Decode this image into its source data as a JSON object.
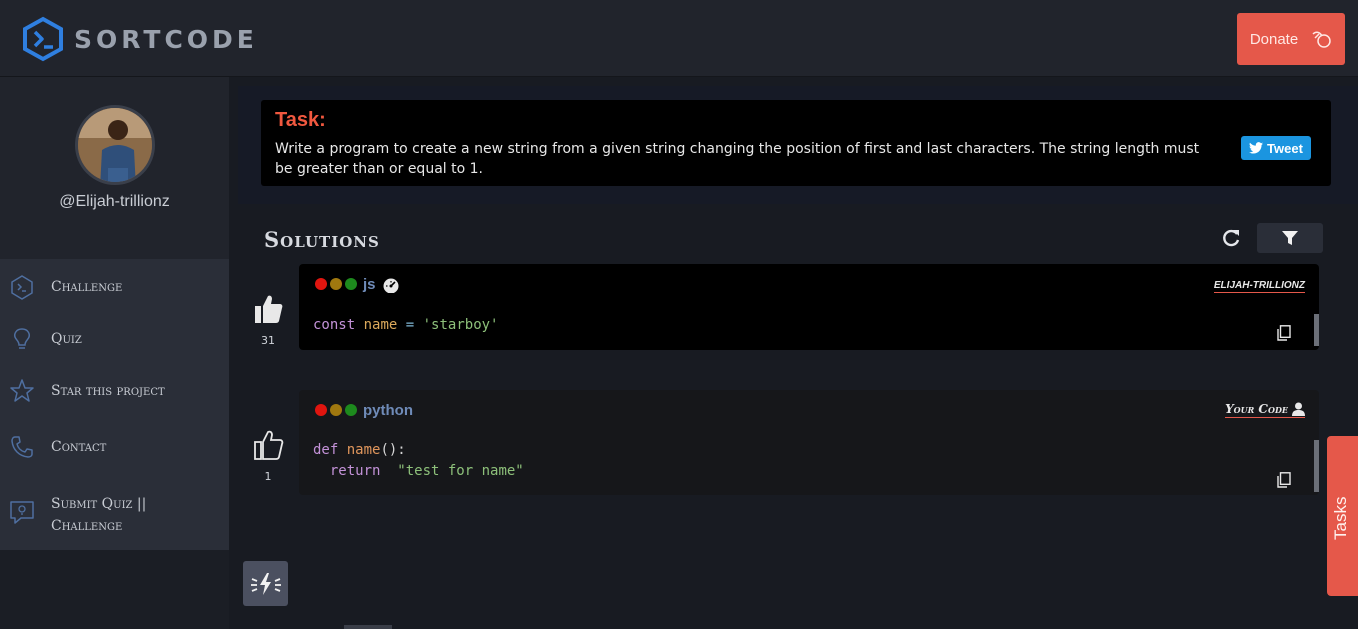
{
  "header": {
    "logo_text": "SORTCODE",
    "donate_label": "Donate"
  },
  "sidebar": {
    "username": "@Elijah-trillionz",
    "items": [
      {
        "label": "Challenge",
        "icon": "terminal-hexagon-icon"
      },
      {
        "label": "Quiz",
        "icon": "lightbulb-icon"
      },
      {
        "label": "Star this project",
        "icon": "star-icon"
      },
      {
        "label": "Contact",
        "icon": "phone-icon"
      },
      {
        "label_line1": "Submit Quiz ||",
        "label_line2": "Challenge",
        "icon": "chat-lightbulb-icon"
      }
    ]
  },
  "task": {
    "title": "Task:",
    "description": "Write a program to create a new string from a given string changing the position of first and last characters. The string length must be greater than or equal to 1.",
    "tweet_label": "Tweet"
  },
  "solutions": {
    "title": "Solutions",
    "items": [
      {
        "votes": "31",
        "lang": "js",
        "author": "ELIJAH-TRILLIONZ",
        "code": {
          "kw": "const",
          "name": "name",
          "op": "=",
          "str": "'starboy'"
        }
      },
      {
        "votes": "1",
        "lang": "python",
        "author": "Your Code",
        "code": {
          "kw": "def",
          "fn": "name",
          "paren": "():",
          "kw2": "return",
          "str": "\"test for name\""
        }
      }
    ]
  },
  "tasks_tab_label": "Tasks",
  "colors": {
    "accent": "#e5584a",
    "task_title": "#f0583f",
    "tweet": "#1b95e0",
    "dot_red": "#e0150f",
    "dot_yellow": "#a0780f",
    "dot_green": "#1d8a1d"
  }
}
